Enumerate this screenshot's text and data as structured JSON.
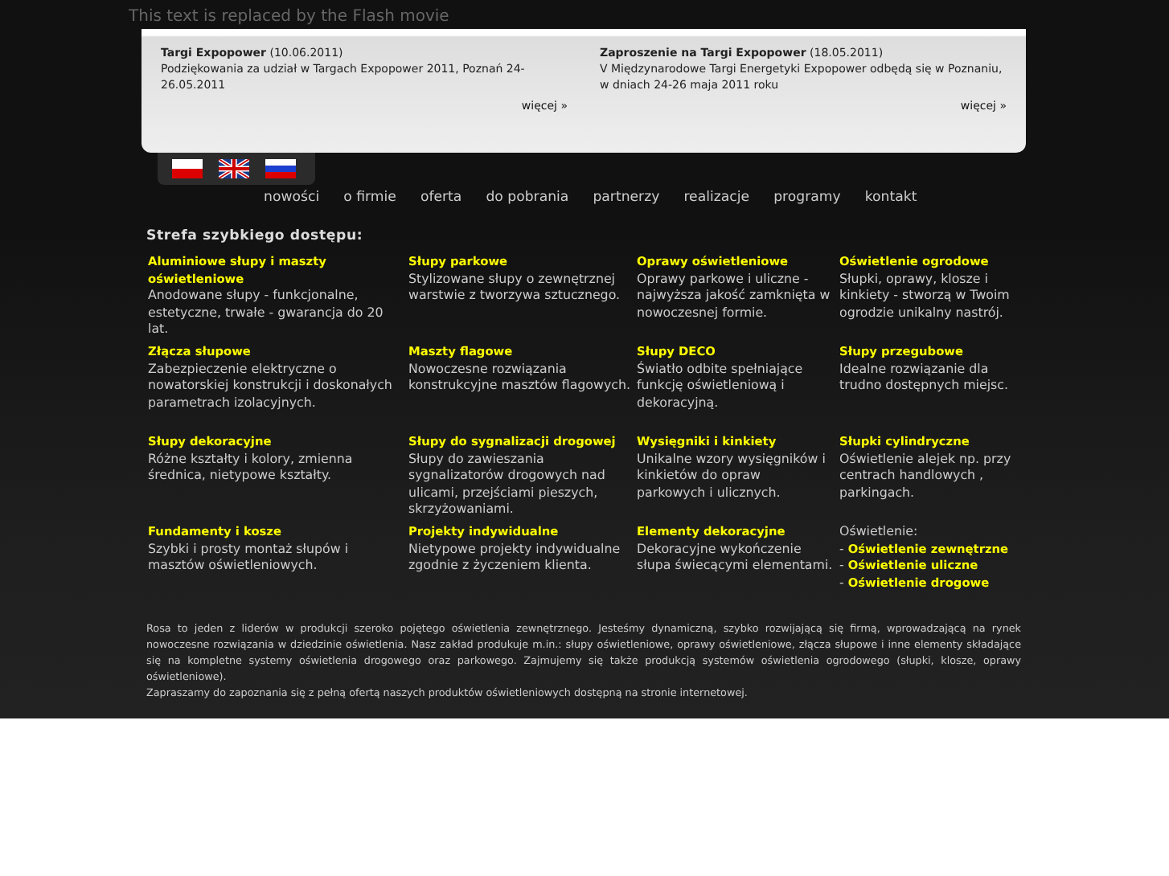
{
  "flash_placeholder": "This text is replaced by the Flash movie",
  "news": [
    {
      "title": "Targi Expopower",
      "date": "(10.06.2011)",
      "text": "Podziękowania za udział w Targach Expopower 2011, Poznań 24-26.05.2011",
      "more": "więcej »"
    },
    {
      "title": "Zaproszenie na Targi Expopower",
      "date": "(18.05.2011)",
      "text": "V Międzynarodowe Targi Energetyki Expopower odbędą się w Poznaniu, w dniach 24-26 maja 2011 roku",
      "more": "więcej »"
    }
  ],
  "languages": [
    {
      "kind": "pl"
    },
    {
      "kind": "en"
    },
    {
      "kind": "ru"
    }
  ],
  "nav": [
    "nowości",
    "o firmie",
    "oferta",
    "do pobrania",
    "partnerzy",
    "realizacje",
    "programy",
    "kontakt"
  ],
  "quick_access": {
    "title": "Strefa szybkiego dostępu:",
    "items": [
      {
        "kind": "product",
        "title": "Aluminiowe słupy i maszty oświetleniowe",
        "text": "Anodowane słupy - funkcjonalne, estetyczne, trwałe - gwarancja do 20 lat."
      },
      {
        "kind": "product",
        "title": "Słupy parkowe",
        "text": "Stylizowane słupy o zewnętrznej warstwie z tworzywa sztucznego."
      },
      {
        "kind": "product",
        "title": "Oprawy oświetleniowe",
        "text": "Oprawy parkowe i uliczne - najwyższa jakość zamknięta w nowoczesnej formie."
      },
      {
        "kind": "product",
        "title": "Oświetlenie ogrodowe",
        "text": "Słupki, oprawy, klosze i kinkiety - stworzą w Twoim ogrodzie unikalny nastrój."
      },
      {
        "kind": "product",
        "title": "Złącza słupowe",
        "text": "Zabezpieczenie elektryczne o nowatorskiej konstrukcji i doskonałych parametrach izolacyjnych."
      },
      {
        "kind": "product",
        "title": "Maszty flagowe",
        "text": "Nowoczesne rozwiązania konstrukcyjne masztów flagowych."
      },
      {
        "kind": "product",
        "title": "Słupy DECO",
        "text": "Światło odbite spełniające funkcję oświetleniową i dekoracyjną."
      },
      {
        "kind": "product",
        "title": "Słupy przegubowe",
        "text": "Idealne rozwiązanie dla trudno dostępnych miejsc."
      },
      {
        "kind": "product",
        "title": "Słupy dekoracyjne",
        "text": "Różne kształty i kolory, zmienna średnica, nietypowe kształty."
      },
      {
        "kind": "product",
        "title": "Słupy do sygnalizacji drogowej",
        "text": "Słupy do zawieszania sygnalizatorów drogowych nad ulicami, przejściami pieszych, skrzyżowaniami."
      },
      {
        "kind": "product",
        "title": "Wysięgniki i kinkiety",
        "text": "Unikalne wzory wysięgników i kinkietów do opraw parkowych i ulicznych."
      },
      {
        "kind": "product",
        "title": "Słupki cylindryczne",
        "text": "Oświetlenie alejek np. przy centrach handlowych , parkingach."
      },
      {
        "kind": "product",
        "title": "Fundamenty i kosze",
        "text": "Szybki i prosty montaż słupów i masztów oświetleniowych."
      },
      {
        "kind": "product",
        "title": "Projekty indywidualne",
        "text": "Nietypowe projekty indywidualne zgodnie z życzeniem klienta."
      },
      {
        "kind": "product",
        "title": "Elementy dekoracyjne",
        "text": "Dekoracyjne wykończenie słupa świecącymi elementami."
      },
      {
        "kind": "links",
        "title": "Oświetlenie:",
        "links": [
          {
            "dash": "-",
            "label": "Oświetlenie zewnętrzne"
          },
          {
            "dash": "-",
            "label": "Oświetlenie uliczne"
          },
          {
            "dash": "-",
            "label": "Oświetlenie drogowe"
          }
        ]
      }
    ]
  },
  "about": [
    "Rosa to jeden z liderów w produkcji szeroko pojętego oświetlenia zewnętrznego. Jesteśmy dynamiczną, szybko rozwijającą się firmą, wprowadzającą na rynek nowoczesne rozwiązania w dziedzinie oświetlenia. Nasz zakład produkuje m.in.: słupy oświetleniowe, oprawy oświetleniowe, złącza słupowe i inne elementy składające się na kompletne systemy oświetlenia drogowego oraz parkowego. Zajmujemy się także produkcją systemów oświetlenia ogrodowego (słupki, klosze, oprawy oświetleniowe).",
    "Zapraszamy do zapoznania się z pełną ofertą naszych produktów oświetleniowych dostępną na stronie internetowej."
  ]
}
